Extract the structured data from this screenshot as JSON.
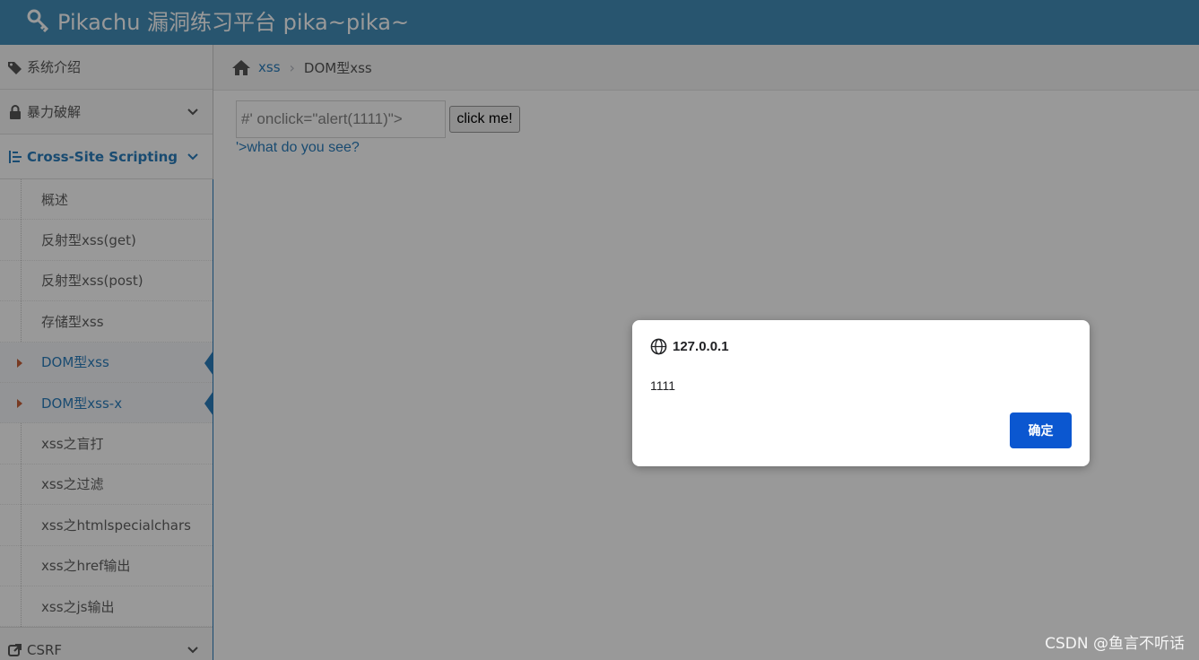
{
  "header": {
    "title": "Pikachu 漏洞练习平台 pika~pika~",
    "icon": "key-icon"
  },
  "sidebar": {
    "items": [
      {
        "label": "系统介绍",
        "icon": "tags-icon"
      },
      {
        "label": "暴力破解",
        "icon": "lock-icon"
      },
      {
        "label": "Cross-Site Scripting",
        "icon": "list-icon"
      }
    ],
    "xss_sub": [
      {
        "label": "概述"
      },
      {
        "label": "反射型xss(get)"
      },
      {
        "label": "反射型xss(post)"
      },
      {
        "label": "存储型xss"
      },
      {
        "label": "DOM型xss"
      },
      {
        "label": "DOM型xss-x"
      },
      {
        "label": "xss之盲打"
      },
      {
        "label": "xss之过滤"
      },
      {
        "label": "xss之htmlspecialchars"
      },
      {
        "label": "xss之href输出"
      },
      {
        "label": "xss之js输出"
      }
    ],
    "csrf": {
      "label": "CSRF",
      "icon": "external-link-icon"
    }
  },
  "breadcrumb": {
    "link": "xss",
    "separator": "›",
    "current": "DOM型xss"
  },
  "form": {
    "input_value": "#' onclick=\"alert(1111)\">",
    "button_label": "click me!",
    "result_text": "'>what do you see?"
  },
  "dialog": {
    "origin": "127.0.0.1",
    "message": "1111",
    "ok_label": "确定"
  },
  "watermark": "CSDN @鱼言不听话",
  "colors": {
    "topbar": "#438eb9",
    "accent": "#2b7dbc",
    "dialog_button": "#0b57d0"
  }
}
